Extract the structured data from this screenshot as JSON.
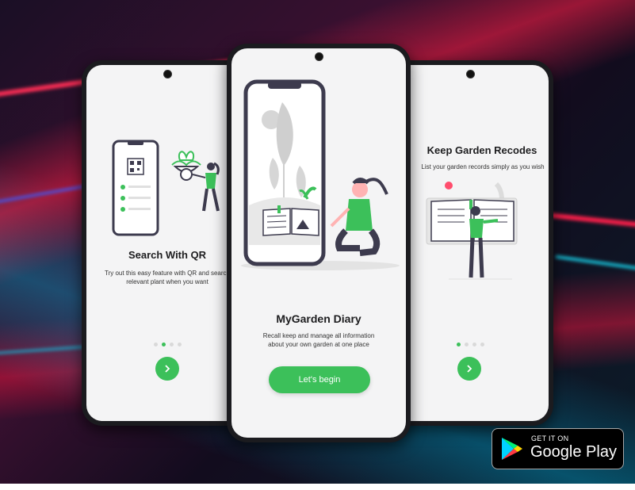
{
  "screens": {
    "left": {
      "title": "Search With QR",
      "description_line1": "Try out this easy feature with QR and search",
      "description_line2": "relevant plant when you want"
    },
    "center": {
      "title": "MyGarden Diary",
      "description_line1": "Recall keep and manage all information",
      "description_line2": "about your own garden at one place",
      "button_label": "Let's begin"
    },
    "right": {
      "title": "Keep Garden Recodes",
      "description_line1": "List your garden records simply as you wish"
    }
  },
  "badge": {
    "top_text": "GET IT ON",
    "main_text": "Google Play"
  },
  "colors": {
    "accent": "#3cc05a",
    "dark": "#3d3b4e",
    "screen_bg": "#f4f4f5"
  },
  "icons": [
    "qr-code-icon",
    "chevron-right-icon",
    "google-play-icon"
  ]
}
